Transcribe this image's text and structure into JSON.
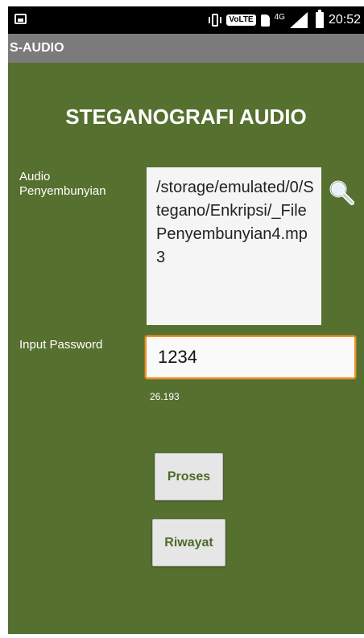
{
  "status_bar": {
    "network_badge": "VoLTE",
    "network_type": "4G",
    "time": "20:52"
  },
  "app": {
    "title": "S-AUDIO"
  },
  "main": {
    "heading": "STEGANOGRAFI AUDIO",
    "audio_label": "Audio Penyembunyian",
    "audio_path": "/storage/emulated/0/Stegano/Enkripsi/_FilePenyembunyian4.mp3",
    "password_label": "Input Password",
    "password_value": "1234",
    "result_value": "26.193",
    "proses_button": "Proses",
    "riwayat_button": "Riwayat"
  },
  "colors": {
    "background": "#56702f",
    "title_bar": "#7b7b7b",
    "input_focus_border": "#f0902a",
    "button_text": "#4e6a2a"
  },
  "icons": {
    "search": "search-icon"
  }
}
